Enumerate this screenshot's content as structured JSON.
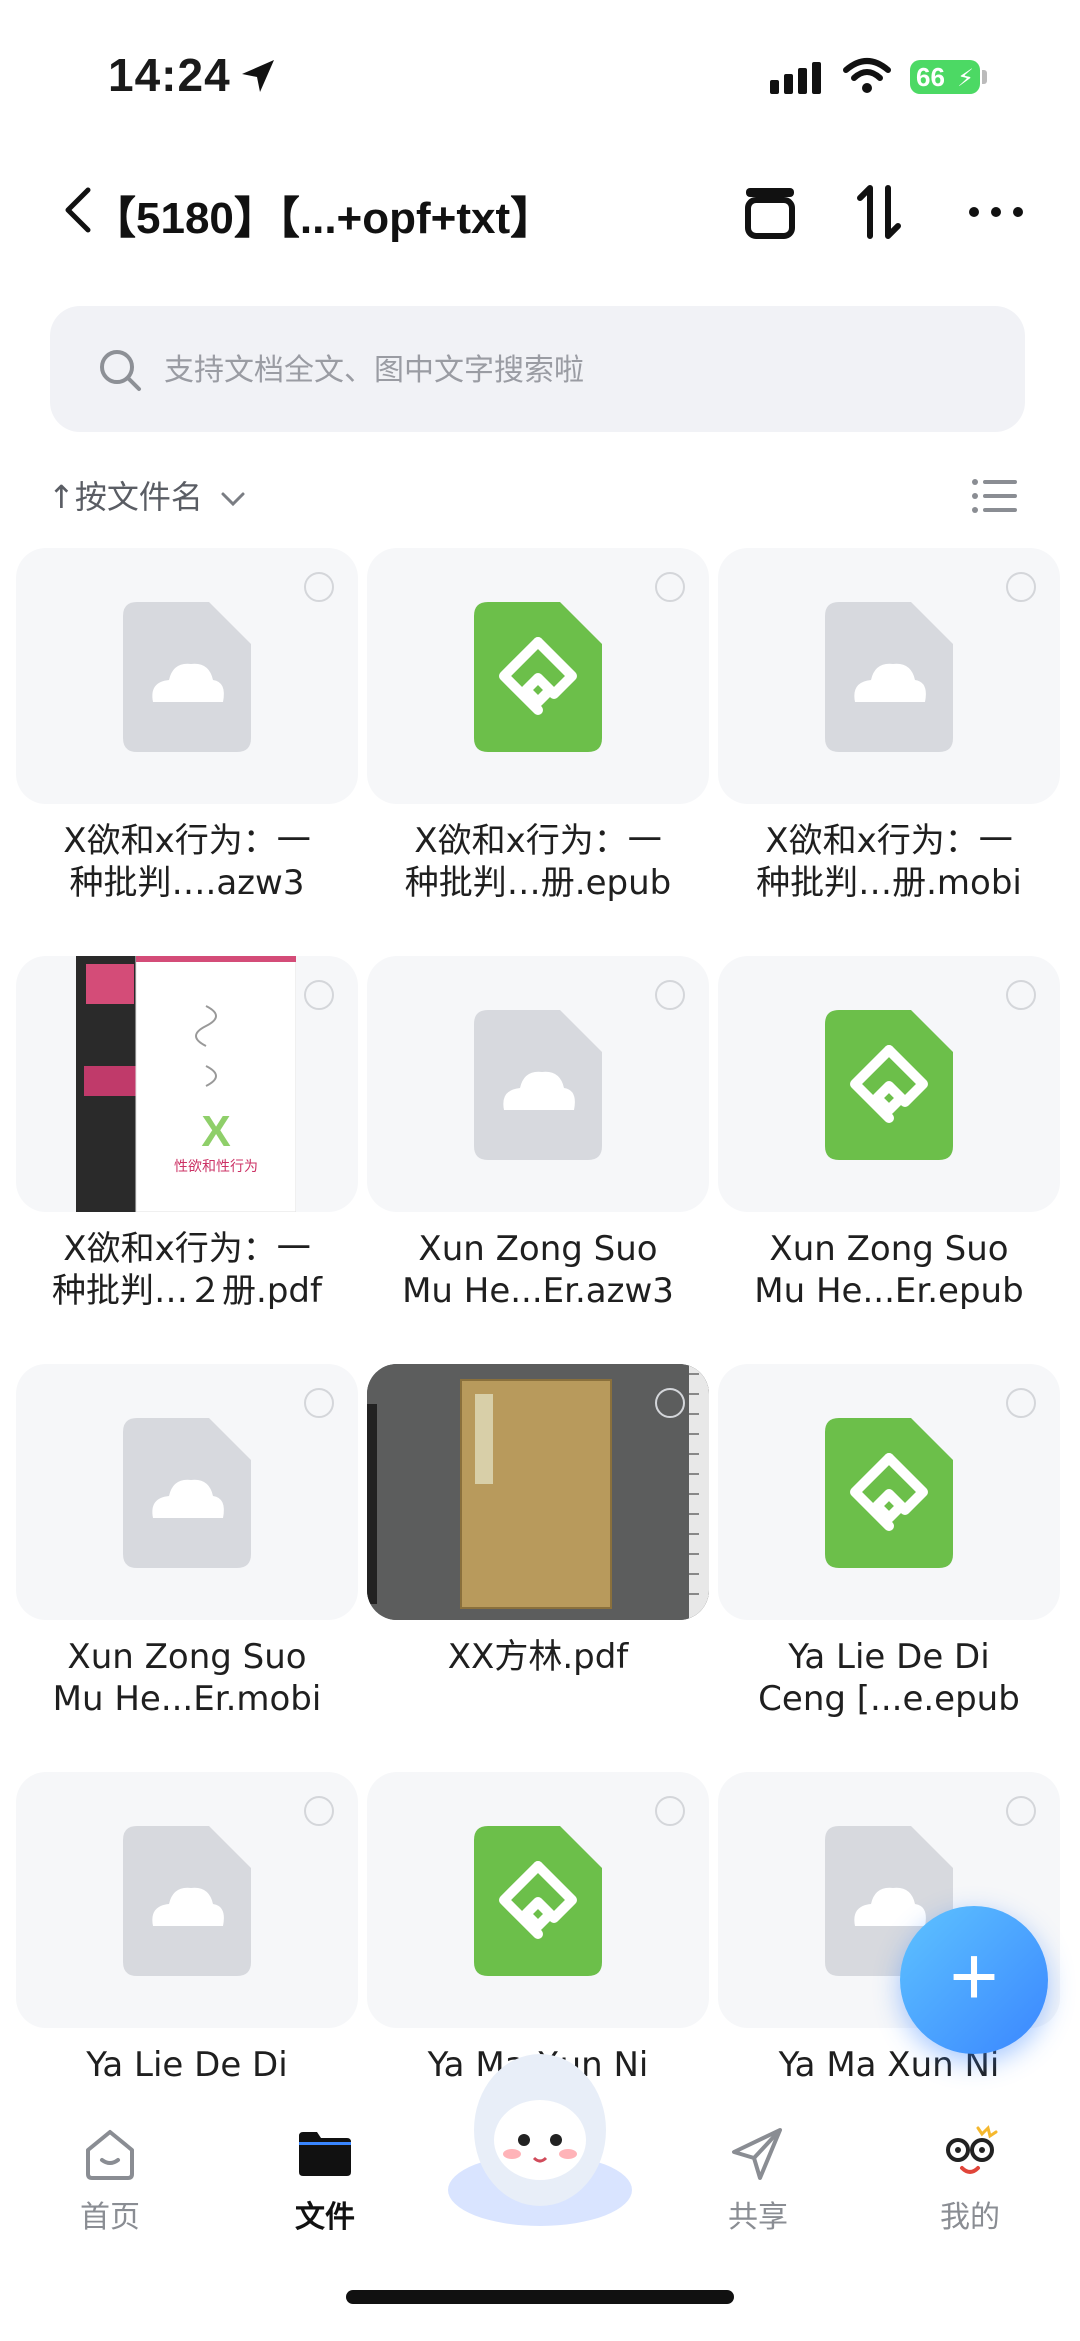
{
  "status_bar": {
    "time": "14:24",
    "battery": "66"
  },
  "header": {
    "title": "【5180】【...+opf+txt】"
  },
  "search": {
    "placeholder": "支持文档全文、图中文字搜索啦"
  },
  "sort": {
    "label": "↑按文件名"
  },
  "files": [
    {
      "name_line1": "X欲和x行为：一",
      "name_line2": "种批判….azw3",
      "type": "cloud"
    },
    {
      "name_line1": "X欲和x行为：一",
      "name_line2": "种批判…册.epub",
      "type": "epub"
    },
    {
      "name_line1": "X欲和x行为：一",
      "name_line2": "种批判…册.mobi",
      "type": "cloud"
    },
    {
      "name_line1": "X欲和x行为：一",
      "name_line2": "种批判…２册.pdf",
      "type": "book-cover",
      "cover_text": "X",
      "cover_subtitle": "性欲和性行为"
    },
    {
      "name_line1": "Xun Zong Suo",
      "name_line2": "Mu He...Er.azw3",
      "type": "cloud"
    },
    {
      "name_line1": "Xun Zong Suo",
      "name_line2": "Mu He...Er.epub",
      "type": "epub"
    },
    {
      "name_line1": "Xun Zong Suo",
      "name_line2": "Mu He...Er.mobi",
      "type": "cloud"
    },
    {
      "name_line1": "XX方林.pdf",
      "name_line2": "",
      "type": "scan"
    },
    {
      "name_line1": "Ya Lie De Di",
      "name_line2": "Ceng [...e.epub",
      "type": "epub"
    },
    {
      "name_line1": "Ya Lie De Di",
      "name_line2": "",
      "type": "cloud"
    },
    {
      "name_line1": "Ya Ma Xun Ni",
      "name_line2": "",
      "type": "epub"
    },
    {
      "name_line1": "Ya Ma Xun Ni",
      "name_line2": "",
      "type": "cloud"
    }
  ],
  "fab": {
    "label": "+"
  },
  "tabs": [
    {
      "label": "首页",
      "icon": "home-icon"
    },
    {
      "label": "文件",
      "icon": "folder-icon",
      "active": true
    },
    {
      "label": "共享",
      "icon": "send-icon"
    },
    {
      "label": "我的",
      "icon": "profile-icon"
    }
  ],
  "colors": {
    "accent": "#3a86ff",
    "epub_green": "#6cbf4a",
    "cloud_grey": "#d7d9de"
  }
}
